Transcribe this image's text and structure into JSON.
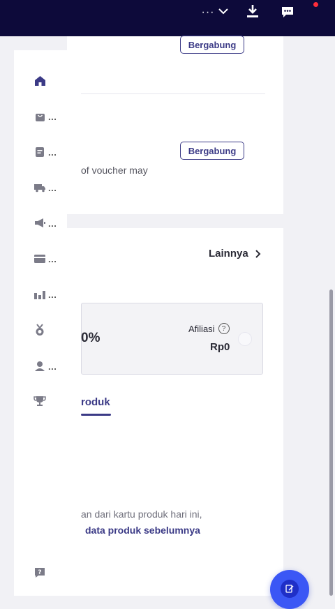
{
  "topbar": {
    "dots": "···",
    "icons": [
      "chevron-down-icon",
      "download-icon",
      "chat-icon"
    ],
    "notification_color": "#ff2d3a"
  },
  "promo": {
    "join_label_1": "Bergabung",
    "join_label_2": "Bergabung",
    "voucher_text": "of voucher may"
  },
  "sidebar": {
    "items": [
      {
        "icon": "home-icon",
        "ellipsis": ""
      },
      {
        "icon": "shopping-bag-icon",
        "ellipsis": "..."
      },
      {
        "icon": "document-icon",
        "ellipsis": "..."
      },
      {
        "icon": "truck-icon",
        "ellipsis": "..."
      },
      {
        "icon": "megaphone-icon",
        "ellipsis": "..."
      },
      {
        "icon": "card-icon",
        "ellipsis": "..."
      },
      {
        "icon": "bar-chart-icon",
        "ellipsis": "..."
      },
      {
        "icon": "medal-icon",
        "ellipsis": ""
      },
      {
        "icon": "user-icon",
        "ellipsis": "..."
      },
      {
        "icon": "trophy-icon",
        "ellipsis": ""
      },
      {
        "icon": "help-icon",
        "ellipsis": ""
      }
    ]
  },
  "performance": {
    "more_label": "Lainnya",
    "percent": "0%",
    "affiliate_label": "Afiliasi",
    "help_glyph": "?",
    "affiliate_value": "Rp0"
  },
  "tabs": {
    "active_label": "roduk"
  },
  "empty_state": {
    "text": "an dari kartu produk hari ini,",
    "link": "data produk sebelumnya"
  },
  "colors": {
    "accent": "#3b3a86",
    "topbar": "#0d0a3a",
    "fab": "#3b57f5"
  }
}
